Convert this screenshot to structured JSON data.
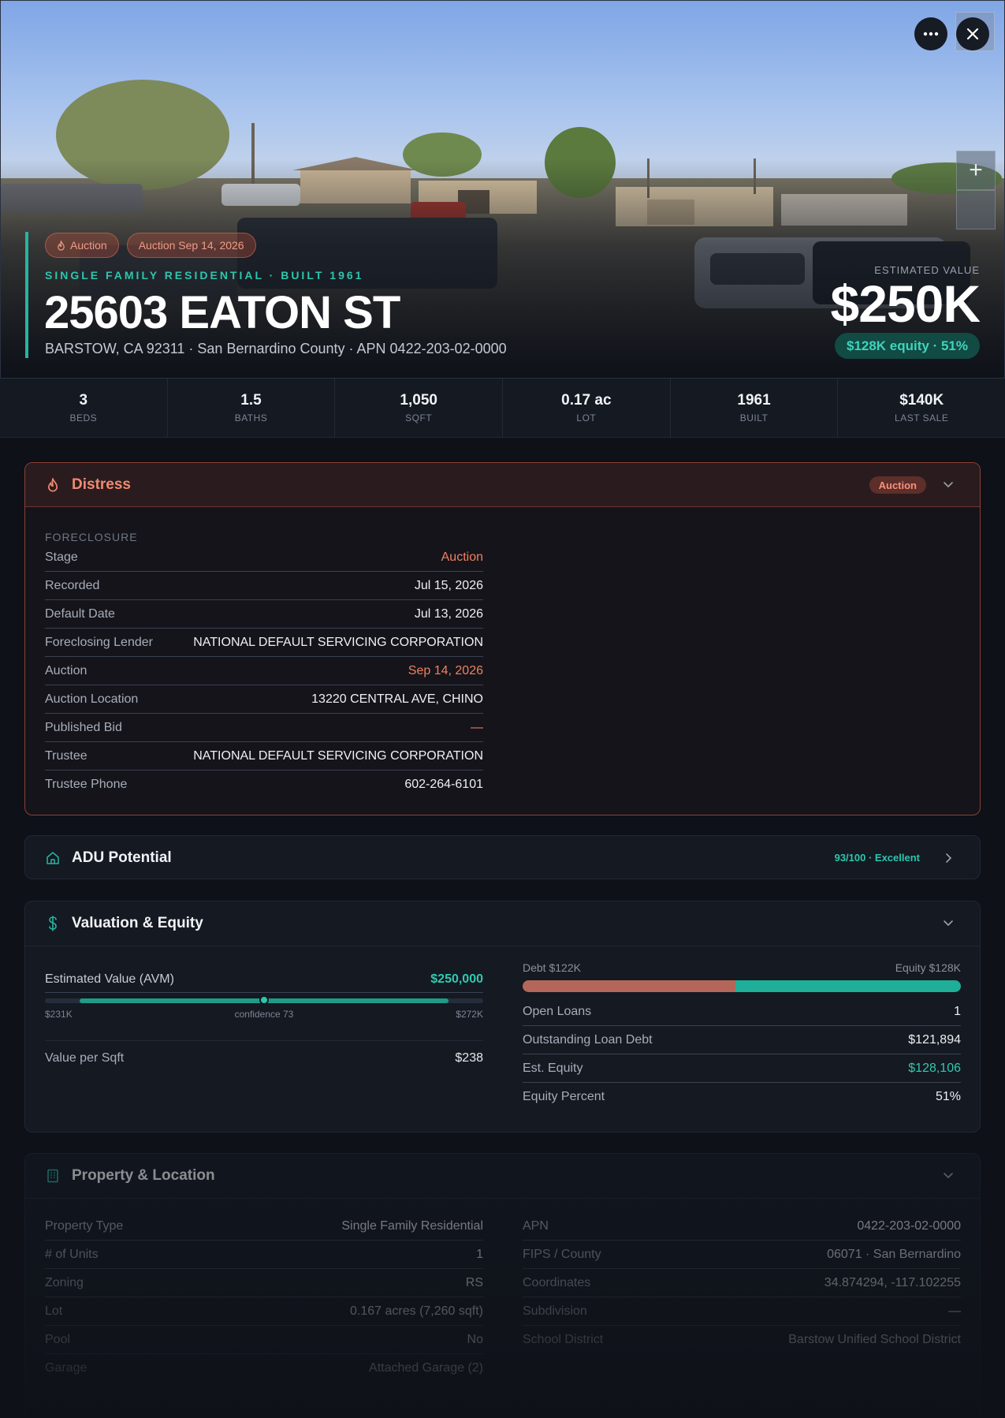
{
  "hero": {
    "pills": [
      {
        "icon": "flame-icon",
        "label": "Auction"
      },
      {
        "label": "Auction Sep 14, 2026"
      }
    ],
    "kicker": "SINGLE FAMILY RESIDENTIAL · BUILT 1961",
    "address": "25603 EATON ST",
    "subaddress": "BARSTOW, CA 92311 · San Bernardino County · APN 0422-203-02-0000",
    "estimated_label": "ESTIMATED VALUE",
    "estimated_value": "$250K",
    "equity_pill": "$128K equity · 51%",
    "more_icon": "more-horizontal-icon",
    "close_icon": "close-icon",
    "zoom_in": "+",
    "zoom_out": ""
  },
  "stats": [
    {
      "value": "3",
      "label": "BEDS"
    },
    {
      "value": "1.5",
      "label": "BATHS"
    },
    {
      "value": "1,050",
      "label": "SQFT"
    },
    {
      "value": "0.17 ac",
      "label": "LOT"
    },
    {
      "value": "1961",
      "label": "BUILT"
    },
    {
      "value": "$140K",
      "label": "LAST SALE"
    }
  ],
  "distress": {
    "title": "Distress",
    "badge": "Auction",
    "section": "FORECLOSURE",
    "rows": [
      {
        "k": "Stage",
        "v": "Auction",
        "tone": "red"
      },
      {
        "k": "Recorded",
        "v": "Jul 15, 2026"
      },
      {
        "k": "Default Date",
        "v": "Jul 13, 2026"
      },
      {
        "k": "Foreclosing Lender",
        "v": "NATIONAL DEFAULT SERVICING CORPORATION"
      },
      {
        "k": "Auction",
        "v": "Sep 14, 2026",
        "tone": "red"
      },
      {
        "k": "Auction Location",
        "v": "13220 CENTRAL AVE, CHINO"
      },
      {
        "k": "Published Bid",
        "v": "—",
        "tone": "red"
      },
      {
        "k": "Trustee",
        "v": "NATIONAL DEFAULT SERVICING CORPORATION"
      },
      {
        "k": "Trustee Phone",
        "v": "602-264-6101"
      }
    ]
  },
  "adu": {
    "title": "ADU Potential",
    "score": "93/100 · Excellent"
  },
  "valuation": {
    "title": "Valuation & Equity",
    "avm_label": "Estimated Value (AVM)",
    "avm_value": "$250,000",
    "range_low": "$231K",
    "confidence": "confidence 73",
    "range_high": "$272K",
    "range_fill_start": 0.08,
    "range_fill_end": 0.92,
    "marker": 0.5,
    "vps_label": "Value per Sqft",
    "vps_value": "$238",
    "debt_label": "Debt $122K",
    "equity_label": "Equity $128K",
    "debt_share": 0.486,
    "rows": [
      {
        "k": "Open Loans",
        "v": "1"
      },
      {
        "k": "Outstanding Loan Debt",
        "v": "$121,894"
      },
      {
        "k": "Est. Equity",
        "v": "$128,106",
        "tone": "green"
      },
      {
        "k": "Equity Percent",
        "v": "51%"
      }
    ]
  },
  "property": {
    "title": "Property & Location",
    "left": [
      {
        "k": "Property Type",
        "v": "Single Family Residential"
      },
      {
        "k": "# of Units",
        "v": "1"
      },
      {
        "k": "Zoning",
        "v": "RS"
      },
      {
        "k": "Lot",
        "v": "0.167 acres (7,260 sqft)"
      },
      {
        "k": "Pool",
        "v": "No"
      },
      {
        "k": "Garage",
        "v": "Attached Garage (2)"
      }
    ],
    "right": [
      {
        "k": "APN",
        "v": "0422-203-02-0000"
      },
      {
        "k": "FIPS / County",
        "v": "06071 · San Bernardino"
      },
      {
        "k": "Coordinates",
        "v": "34.874294, -117.102255"
      },
      {
        "k": "Subdivision",
        "v": "—"
      },
      {
        "k": "School District",
        "v": "Barstow Unified School District"
      }
    ]
  },
  "colors": {
    "accent": "#26b5a0",
    "danger": "#f0805f",
    "debt": "#b5665a",
    "equity": "#1fae98"
  }
}
